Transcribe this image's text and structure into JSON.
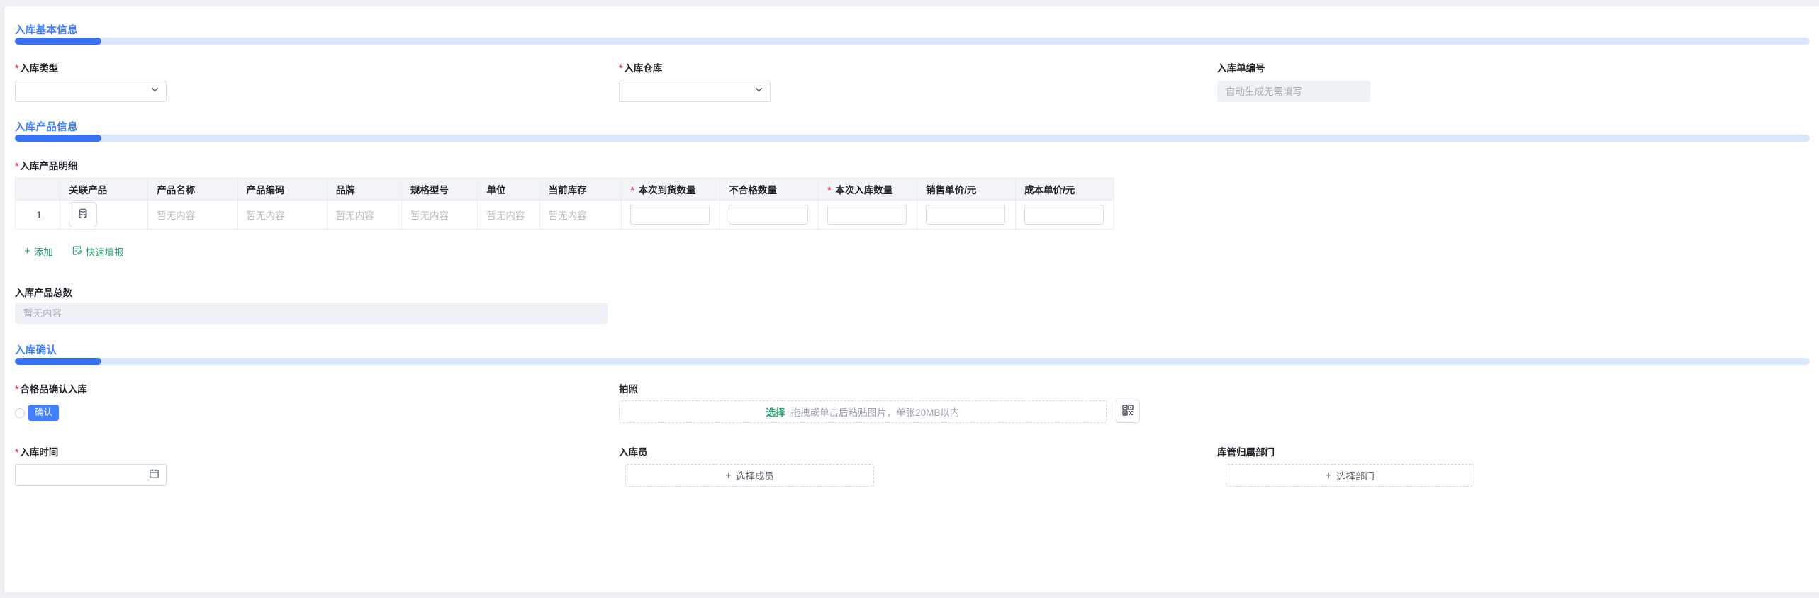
{
  "misc": {
    "required_mark": "*",
    "plus": "+"
  },
  "colors": {
    "accent_blue": "#3D7EFC",
    "progress_fill_blue": "#3671F6",
    "progress_track_blue": "#D9E6FD",
    "success_green": "#2BA471",
    "required_red": "#E34D59",
    "confirm_button_blue": "#4080FF"
  },
  "sections": {
    "basic_title": "入库基本信息",
    "products_title": "入库产品信息",
    "confirm_title": "入库确认"
  },
  "basic": {
    "type_label": "入库类型",
    "warehouse_label": "入库仓库",
    "order_no_label": "入库单编号",
    "order_no_placeholder": "自动生成无需填写"
  },
  "products": {
    "detail_label": "入库产品明细",
    "add_label": "添加",
    "quick_fill_label": "快速填报",
    "total_label": "入库产品总数",
    "total_placeholder": "暂无内容",
    "table": {
      "headers": [
        "",
        "关联产品",
        "产品名称",
        "产品编码",
        "品牌",
        "规格型号",
        "单位",
        "当前库存",
        "本次到货数量",
        "不合格数量",
        "本次入库数量",
        "销售单价/元",
        "成本单价/元"
      ],
      "required_columns": [
        "本次到货数量",
        "本次入库数量"
      ],
      "row": {
        "index": "1",
        "empty_text": "暂无内容"
      }
    }
  },
  "confirm": {
    "qualified_label": "合格品确认入库",
    "confirm_button": "确认",
    "photo_label": "拍照",
    "photo_select": "选择",
    "photo_hint": "拖拽或单击后粘贴图片，单张20MB以内",
    "time_label": "入库时间",
    "operator_label": "入库员",
    "operator_button": "选择成员",
    "dept_label": "库管归属部门",
    "dept_button": "选择部门"
  }
}
